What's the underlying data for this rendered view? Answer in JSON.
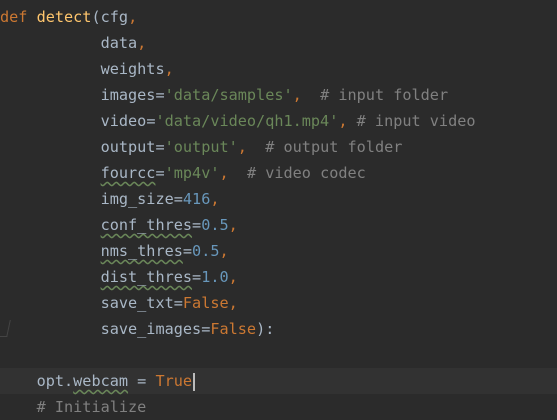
{
  "editor": {
    "lines": [
      {
        "indent": "",
        "tokens": [
          {
            "t": "def",
            "c": "kw"
          },
          {
            "t": " ",
            "c": "id"
          },
          {
            "t": "detect",
            "c": "fn"
          },
          {
            "t": "(",
            "c": "id"
          },
          {
            "t": "cfg",
            "c": "id"
          },
          {
            "t": ",",
            "c": "punc"
          }
        ]
      },
      {
        "indent": "           ",
        "tokens": [
          {
            "t": "data",
            "c": "id"
          },
          {
            "t": ",",
            "c": "punc"
          }
        ]
      },
      {
        "indent": "           ",
        "tokens": [
          {
            "t": "weights",
            "c": "id"
          },
          {
            "t": ",",
            "c": "punc"
          }
        ]
      },
      {
        "indent": "           ",
        "tokens": [
          {
            "t": "images",
            "c": "id"
          },
          {
            "t": "=",
            "c": "id"
          },
          {
            "t": "'data/samples'",
            "c": "str"
          },
          {
            "t": ",",
            "c": "punc"
          },
          {
            "t": "  # input folder",
            "c": "cmt"
          }
        ]
      },
      {
        "indent": "           ",
        "tokens": [
          {
            "t": "video",
            "c": "id"
          },
          {
            "t": "=",
            "c": "id"
          },
          {
            "t": "'data/video/qh1.mp4'",
            "c": "str"
          },
          {
            "t": ",",
            "c": "punc"
          },
          {
            "t": " # input video",
            "c": "cmt"
          }
        ]
      },
      {
        "indent": "           ",
        "tokens": [
          {
            "t": "output",
            "c": "id"
          },
          {
            "t": "=",
            "c": "id"
          },
          {
            "t": "'output'",
            "c": "str"
          },
          {
            "t": ",",
            "c": "punc"
          },
          {
            "t": "  # output folder",
            "c": "cmt"
          }
        ]
      },
      {
        "indent": "           ",
        "tokens": [
          {
            "t": "fourcc",
            "c": "id wavy"
          },
          {
            "t": "=",
            "c": "id"
          },
          {
            "t": "'mp4v'",
            "c": "str"
          },
          {
            "t": ",",
            "c": "punc"
          },
          {
            "t": "  # video codec",
            "c": "cmt"
          }
        ]
      },
      {
        "indent": "           ",
        "tokens": [
          {
            "t": "img_size",
            "c": "id"
          },
          {
            "t": "=",
            "c": "id"
          },
          {
            "t": "416",
            "c": "num"
          },
          {
            "t": ",",
            "c": "punc"
          }
        ]
      },
      {
        "indent": "           ",
        "tokens": [
          {
            "t": "conf_thres",
            "c": "id wavy"
          },
          {
            "t": "=",
            "c": "id"
          },
          {
            "t": "0.5",
            "c": "num"
          },
          {
            "t": ",",
            "c": "punc"
          }
        ]
      },
      {
        "indent": "           ",
        "tokens": [
          {
            "t": "nms_thres",
            "c": "id wavy"
          },
          {
            "t": "=",
            "c": "id"
          },
          {
            "t": "0.5",
            "c": "num"
          },
          {
            "t": ",",
            "c": "punc"
          }
        ]
      },
      {
        "indent": "           ",
        "tokens": [
          {
            "t": "dist_thres",
            "c": "id wavy"
          },
          {
            "t": "=",
            "c": "id"
          },
          {
            "t": "1.0",
            "c": "num"
          },
          {
            "t": ",",
            "c": "punc"
          }
        ]
      },
      {
        "indent": "           ",
        "tokens": [
          {
            "t": "save_txt",
            "c": "id"
          },
          {
            "t": "=",
            "c": "id"
          },
          {
            "t": "False",
            "c": "kw"
          },
          {
            "t": ",",
            "c": "punc"
          }
        ]
      },
      {
        "indent": "           ",
        "tokens": [
          {
            "t": "save_images",
            "c": "id"
          },
          {
            "t": "=",
            "c": "id"
          },
          {
            "t": "False",
            "c": "kw"
          },
          {
            "t": "):",
            "c": "id"
          }
        ]
      },
      {
        "indent": "",
        "tokens": []
      },
      {
        "indent": "    ",
        "current": true,
        "tokens": [
          {
            "t": "opt.",
            "c": "id"
          },
          {
            "t": "webcam",
            "c": "id wavy"
          },
          {
            "t": " = ",
            "c": "id"
          },
          {
            "t": "True",
            "c": "kw"
          }
        ]
      },
      {
        "indent": "    ",
        "tokens": [
          {
            "t": "# Initialize",
            "c": "cmt"
          }
        ]
      }
    ]
  }
}
